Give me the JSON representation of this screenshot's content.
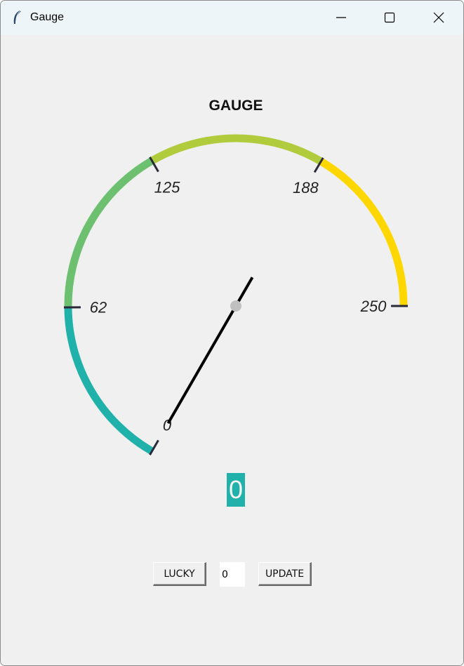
{
  "window": {
    "title": "Gauge"
  },
  "gauge": {
    "title": "GAUGE",
    "min": 0,
    "max": 250,
    "value": 0,
    "value_text": "0",
    "ticks": [
      {
        "value": 0,
        "label": "0"
      },
      {
        "value": 62,
        "label": "62"
      },
      {
        "value": 125,
        "label": "125"
      },
      {
        "value": 188,
        "label": "188"
      },
      {
        "value": 250,
        "label": "250"
      }
    ],
    "segments": [
      {
        "from": 0,
        "to": 62,
        "color": "#20b2aa"
      },
      {
        "from": 62,
        "to": 125,
        "color": "#6cc070"
      },
      {
        "from": 125,
        "to": 188,
        "color": "#b0cb3c"
      },
      {
        "from": 188,
        "to": 250,
        "color": "#ffd700"
      }
    ],
    "needle_color": "#000000",
    "hub_color": "#c0c0c0",
    "tick_color": "#2a2a3a",
    "display_color": "#20b2aa"
  },
  "controls": {
    "lucky_label": "LUCKY",
    "entry_value": "0",
    "update_label": "UPDATE"
  },
  "icons": {
    "app": "feather-icon",
    "minimize": "minimize-icon",
    "maximize": "maximize-icon",
    "close": "close-icon"
  }
}
